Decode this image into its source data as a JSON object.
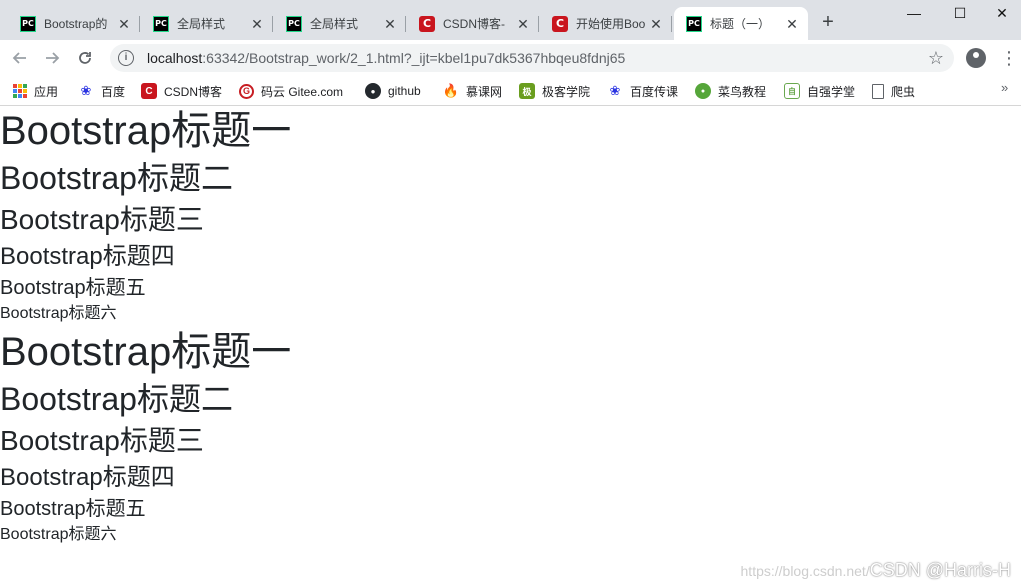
{
  "tabs": [
    {
      "title": "Bootstrap的",
      "favicon": "pycharm-icon",
      "active": false
    },
    {
      "title": "全局样式",
      "favicon": "pycharm-icon",
      "active": false
    },
    {
      "title": "全局样式",
      "favicon": "pycharm-icon",
      "active": false
    },
    {
      "title": "CSDN博客-",
      "favicon": "csdn-icon",
      "active": false
    },
    {
      "title": "开始使用Boo",
      "favicon": "csdn-icon",
      "active": false
    },
    {
      "title": "标题（一）",
      "favicon": "pycharm-icon",
      "active": true
    }
  ],
  "tab_close_glyph": "✕",
  "new_tab_glyph": "+",
  "window_controls": {
    "minimize": "—",
    "maximize": "☐",
    "close": "✕"
  },
  "address": {
    "host": "localhost",
    "rest": ":63342/Bootstrap_work/2_1.html?_ijt=kbel1pu7dk5367hbqeu8fdnj65"
  },
  "bookmarks": [
    {
      "label": "应用",
      "icon": "apps-grid-icon"
    },
    {
      "label": "百度",
      "icon": "baidu-paw-icon"
    },
    {
      "label": "CSDN博客",
      "icon": "csdn-icon"
    },
    {
      "label": "码云 Gitee.com",
      "icon": "gitee-icon"
    },
    {
      "label": "github",
      "icon": "github-icon"
    },
    {
      "label": "慕课网",
      "icon": "mooc-flame-icon"
    },
    {
      "label": "极客学院",
      "icon": "geek-icon"
    },
    {
      "label": "百度传课",
      "icon": "baidu-paw-icon"
    },
    {
      "label": "菜鸟教程",
      "icon": "runoob-icon"
    },
    {
      "label": "自强学堂",
      "icon": "zqxt-icon"
    },
    {
      "label": "爬虫",
      "icon": "page-icon"
    }
  ],
  "bookmarks_overflow": "»",
  "headings_group_1": {
    "h1": "Bootstrap标题一",
    "h2": "Bootstrap标题二",
    "h3": "Bootstrap标题三",
    "h4": "Bootstrap标题四",
    "h5": "Bootstrap标题五",
    "h6": "Bootstrap标题六"
  },
  "headings_group_2": {
    "h1": "Bootstrap标题一",
    "h2": "Bootstrap标题二",
    "h3": "Bootstrap标题三",
    "h4": "Bootstrap标题四",
    "h5": "Bootstrap标题五",
    "h6": "Bootstrap标题六"
  },
  "watermark": {
    "faint": "https://blog.csdn.net/",
    "main": "CSDN @Harris-H"
  },
  "colors": {
    "tabstrip": "#dee1e6",
    "omnibox": "#f1f3f4",
    "text": "#212529",
    "csdn_red": "#c9151e"
  }
}
